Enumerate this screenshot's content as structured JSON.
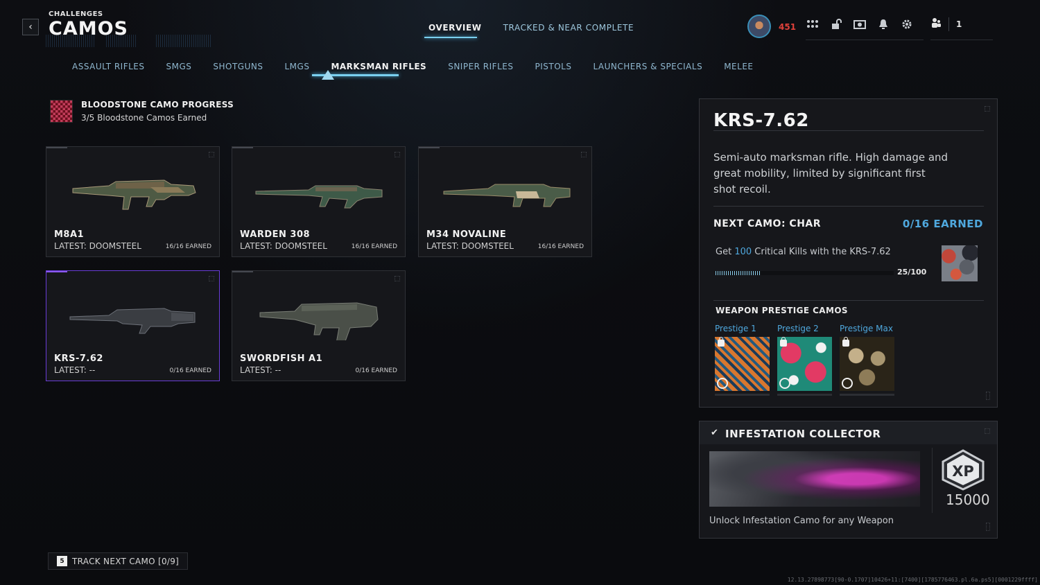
{
  "header": {
    "subtitle": "CHALLENGES",
    "title": "CAMOS",
    "tabs": [
      {
        "label": "OVERVIEW",
        "active": true
      },
      {
        "label": "TRACKED & NEAR COMPLETE",
        "active": false
      }
    ],
    "player_level": "451",
    "party_count": "1",
    "icons": [
      "grid-icon",
      "unlock-icon",
      "store-icon",
      "bell-icon",
      "gear-icon"
    ]
  },
  "categories": [
    {
      "label": "ASSAULT RIFLES"
    },
    {
      "label": "SMGS"
    },
    {
      "label": "SHOTGUNS"
    },
    {
      "label": "LMGS"
    },
    {
      "label": "MARKSMAN RIFLES",
      "active": true
    },
    {
      "label": "SNIPER RIFLES"
    },
    {
      "label": "PISTOLS"
    },
    {
      "label": "LAUNCHERS & SPECIALS"
    },
    {
      "label": "MELEE"
    }
  ],
  "bloodstone": {
    "title": "BLOODSTONE CAMO PROGRESS",
    "subtitle": "3/5 Bloodstone Camos Earned"
  },
  "weapons": [
    {
      "name": "M8A1",
      "latest": "LATEST: DOOMSTEEL",
      "earned": "16/16 EARNED"
    },
    {
      "name": "WARDEN 308",
      "latest": "LATEST: DOOMSTEEL",
      "earned": "16/16 EARNED"
    },
    {
      "name": "M34 NOVALINE",
      "latest": "LATEST: DOOMSTEEL",
      "earned": "16/16 EARNED"
    },
    {
      "name": "KRS-7.62",
      "latest": "LATEST: --",
      "earned": "0/16 EARNED",
      "selected": true
    },
    {
      "name": "SWORDFISH A1",
      "latest": "LATEST: --",
      "earned": "0/16 EARNED"
    }
  ],
  "detail": {
    "title": "KRS-7.62",
    "description": "Semi-auto marksman rifle. High damage and great mobility, limited by significant first shot recoil.",
    "next_camo_label": "NEXT CAMO: CHAR",
    "earned_label": "0/16 EARNED",
    "challenge_prefix": "Get ",
    "challenge_highlight": "100",
    "challenge_suffix": " Critical Kills with the KRS-7.62",
    "progress_text": "25/100",
    "progress_fraction": 0.25,
    "prestige_heading": "WEAPON PRESTIGE CAMOS",
    "prestige": [
      {
        "label": "Prestige 1"
      },
      {
        "label": "Prestige 2"
      },
      {
        "label": "Prestige Max"
      }
    ]
  },
  "infestation": {
    "title": "INFESTATION COLLECTOR",
    "xp_label": "XP",
    "xp_amount": "15000",
    "description": "Unlock Infestation Camo for any Weapon"
  },
  "footer": {
    "key": "5",
    "track_label": "TRACK NEXT CAMO [0/9]",
    "version": "12.13.27898773[90-0.1707]10426+11:[7400][1785776463.pl.6a.ps5][0001229ffff]"
  },
  "colors": {
    "accent_blue": "#4fa8de",
    "tab_underline": "#7ad0f0",
    "selected_border": "#6a3dd8",
    "level_red": "#e0413a"
  }
}
